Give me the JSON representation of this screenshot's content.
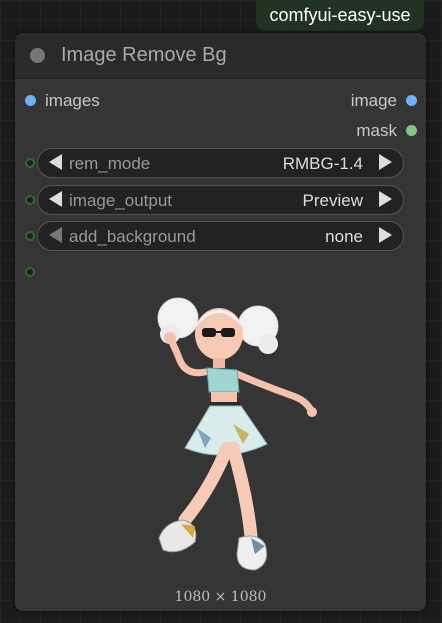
{
  "badge": {
    "text": "comfyui-easy-use"
  },
  "node": {
    "title": "Image Remove Bg",
    "inputs": [
      {
        "label": "images",
        "color": "#6cb4f4"
      }
    ],
    "outputs": [
      {
        "label": "image",
        "color": "#6cb4f4"
      },
      {
        "label": "mask",
        "color": "#81c784"
      }
    ],
    "widgets": [
      {
        "label": "rem_mode",
        "value": "RMBG-1.4"
      },
      {
        "label": "image_output",
        "value": "Preview"
      },
      {
        "label": "add_background",
        "value": "none"
      }
    ],
    "preview": {
      "dimensions": "1080 × 1080",
      "description_icon": "chibi-girl-figure"
    }
  }
}
